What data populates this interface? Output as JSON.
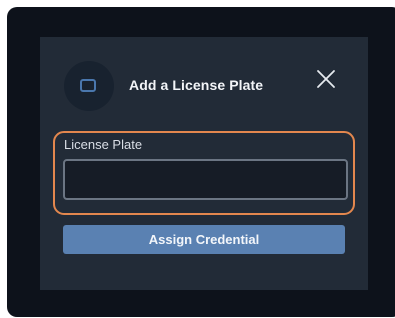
{
  "dialog": {
    "title": "Add a License Plate",
    "icon": "license-plate-icon",
    "close_icon": "close-icon"
  },
  "form": {
    "license_plate_label": "License Plate",
    "license_plate_value": "",
    "license_plate_placeholder": ""
  },
  "actions": {
    "assign_label": "Assign Credential"
  },
  "colors": {
    "background": "#0d121b",
    "modal": "#222b37",
    "focus_ring": "#e3874e",
    "primary_button": "#5a81b2",
    "icon_accent": "#4a77ad"
  }
}
